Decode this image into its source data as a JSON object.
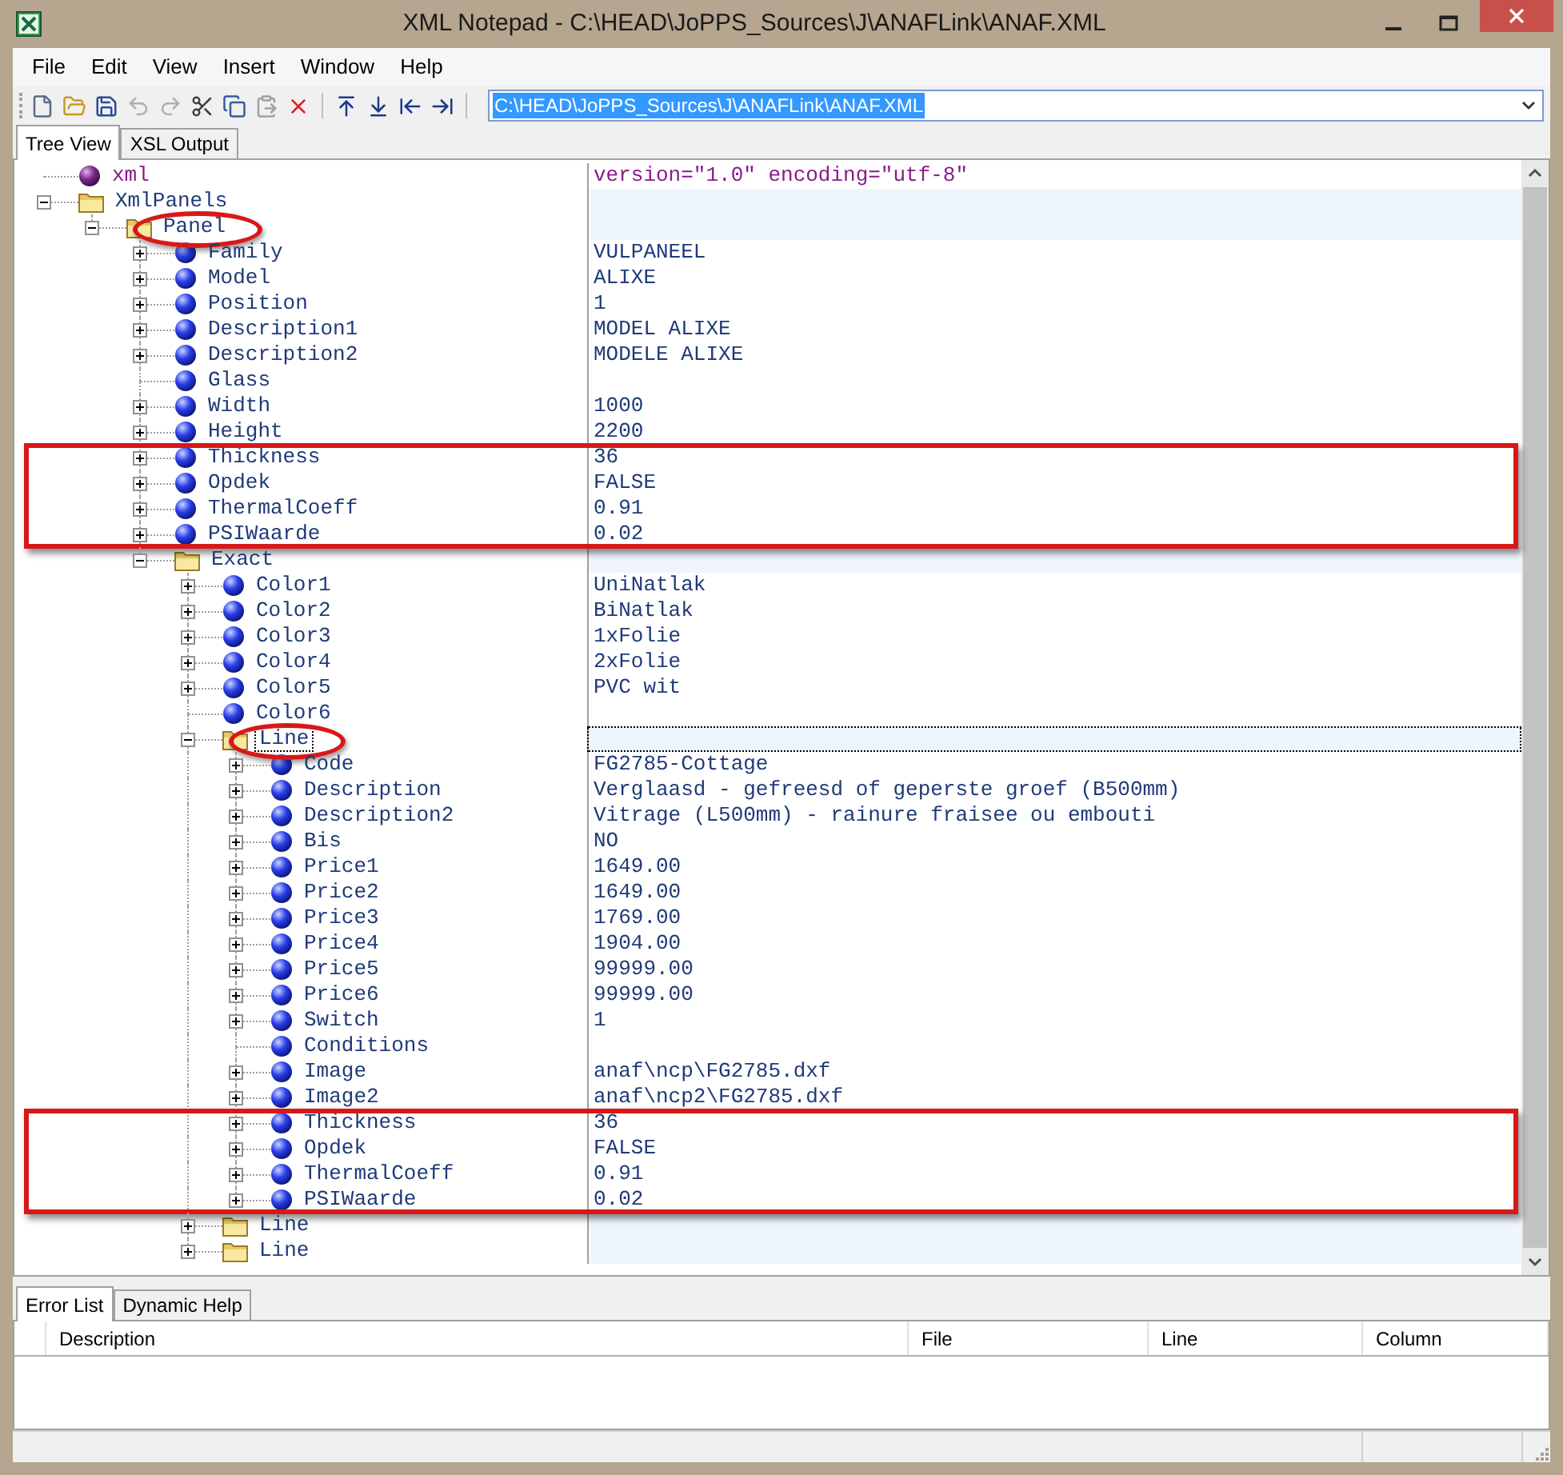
{
  "window": {
    "title": "XML Notepad - C:\\HEAD\\JoPPS_Sources\\J\\ANAFLink\\ANAF.XML"
  },
  "menu": [
    "File",
    "Edit",
    "View",
    "Insert",
    "Window",
    "Help"
  ],
  "toolbar": {
    "location": "C:\\HEAD\\JoPPS_Sources\\J\\ANAFLink\\ANAF.XML",
    "highlighted": true
  },
  "tabs": [
    {
      "label": "Tree View",
      "selected": true
    },
    {
      "label": "XSL Output",
      "selected": false
    }
  ],
  "tree": [
    {
      "name": "xml",
      "kind": "pi",
      "value": "version=\"1.0\" encoding=\"utf-8\"",
      "selected": false,
      "framed": false,
      "circled": false
    },
    {
      "name": "XmlPanels",
      "kind": "folder",
      "expanded": true,
      "selected": false,
      "framed": false,
      "circled": false,
      "children": [
        {
          "name": "Panel",
          "kind": "folder",
          "expanded": true,
          "selected": false,
          "framed": false,
          "circled": true,
          "children": [
            {
              "name": "Family",
              "kind": "element",
              "expanded": false,
              "value": "VULPANEEL",
              "selected": false,
              "framed": false,
              "circled": false
            },
            {
              "name": "Model",
              "kind": "element",
              "expanded": false,
              "value": "ALIXE",
              "selected": false,
              "framed": false,
              "circled": false
            },
            {
              "name": "Position",
              "kind": "element",
              "expanded": false,
              "value": "1",
              "selected": false,
              "framed": false,
              "circled": false
            },
            {
              "name": "Description1",
              "kind": "element",
              "expanded": false,
              "value": "MODEL ALIXE",
              "selected": false,
              "framed": false,
              "circled": false
            },
            {
              "name": "Description2",
              "kind": "element",
              "expanded": false,
              "value": "MODELE ALIXE",
              "selected": false,
              "framed": false,
              "circled": false
            },
            {
              "name": "Glass",
              "kind": "element",
              "selected": false,
              "framed": false,
              "circled": false
            },
            {
              "name": "Width",
              "kind": "element",
              "expanded": false,
              "value": "1000",
              "selected": false,
              "framed": false,
              "circled": false
            },
            {
              "name": "Height",
              "kind": "element",
              "expanded": false,
              "value": "2200",
              "selected": false,
              "framed": false,
              "circled": false
            },
            {
              "name": "Thickness",
              "kind": "element",
              "expanded": false,
              "value": "36",
              "selected": false,
              "framed": true,
              "circled": false
            },
            {
              "name": "Opdek",
              "kind": "element",
              "expanded": false,
              "value": "FALSE",
              "selected": false,
              "framed": true,
              "circled": false
            },
            {
              "name": "ThermalCoeff",
              "kind": "element",
              "expanded": false,
              "value": "0.91",
              "selected": false,
              "framed": true,
              "circled": false
            },
            {
              "name": "PSIWaarde",
              "kind": "element",
              "expanded": false,
              "value": "0.02",
              "selected": false,
              "framed": true,
              "circled": false
            },
            {
              "name": "Exact",
              "kind": "folder",
              "expanded": true,
              "selected": false,
              "framed": false,
              "circled": false,
              "children": [
                {
                  "name": "Color1",
                  "kind": "element",
                  "expanded": false,
                  "value": "UniNatlak",
                  "selected": false,
                  "framed": false,
                  "circled": false
                },
                {
                  "name": "Color2",
                  "kind": "element",
                  "expanded": false,
                  "value": "BiNatlak",
                  "selected": false,
                  "framed": false,
                  "circled": false
                },
                {
                  "name": "Color3",
                  "kind": "element",
                  "expanded": false,
                  "value": "1xFolie",
                  "selected": false,
                  "framed": false,
                  "circled": false
                },
                {
                  "name": "Color4",
                  "kind": "element",
                  "expanded": false,
                  "value": "2xFolie",
                  "selected": false,
                  "framed": false,
                  "circled": false
                },
                {
                  "name": "Color5",
                  "kind": "element",
                  "expanded": false,
                  "value": "PVC wit",
                  "selected": false,
                  "framed": false,
                  "circled": false
                },
                {
                  "name": "Color6",
                  "kind": "element",
                  "selected": false,
                  "framed": false,
                  "circled": false
                },
                {
                  "name": "Line",
                  "kind": "folder",
                  "expanded": true,
                  "selected": true,
                  "framed": false,
                  "circled": true,
                  "children": [
                    {
                      "name": "Code",
                      "kind": "element",
                      "expanded": false,
                      "value": "FG2785-Cottage",
                      "selected": false,
                      "framed": false,
                      "circled": false
                    },
                    {
                      "name": "Description",
                      "kind": "element",
                      "expanded": false,
                      "value": "Verglaasd - gefreesd of geperste groef (B500mm)",
                      "selected": false,
                      "framed": false,
                      "circled": false
                    },
                    {
                      "name": "Description2",
                      "kind": "element",
                      "expanded": false,
                      "value": "Vitrage (L500mm) - rainure fraisee ou embouti",
                      "selected": false,
                      "framed": false,
                      "circled": false
                    },
                    {
                      "name": "Bis",
                      "kind": "element",
                      "expanded": false,
                      "value": "NO",
                      "selected": false,
                      "framed": false,
                      "circled": false
                    },
                    {
                      "name": "Price1",
                      "kind": "element",
                      "expanded": false,
                      "value": "1649.00",
                      "selected": false,
                      "framed": false,
                      "circled": false
                    },
                    {
                      "name": "Price2",
                      "kind": "element",
                      "expanded": false,
                      "value": "1649.00",
                      "selected": false,
                      "framed": false,
                      "circled": false
                    },
                    {
                      "name": "Price3",
                      "kind": "element",
                      "expanded": false,
                      "value": "1769.00",
                      "selected": false,
                      "framed": false,
                      "circled": false
                    },
                    {
                      "name": "Price4",
                      "kind": "element",
                      "expanded": false,
                      "value": "1904.00",
                      "selected": false,
                      "framed": false,
                      "circled": false
                    },
                    {
                      "name": "Price5",
                      "kind": "element",
                      "expanded": false,
                      "value": "99999.00",
                      "selected": false,
                      "framed": false,
                      "circled": false
                    },
                    {
                      "name": "Price6",
                      "kind": "element",
                      "expanded": false,
                      "value": "99999.00",
                      "selected": false,
                      "framed": false,
                      "circled": false
                    },
                    {
                      "name": "Switch",
                      "kind": "element",
                      "expanded": false,
                      "value": "1",
                      "selected": false,
                      "framed": false,
                      "circled": false
                    },
                    {
                      "name": "Conditions",
                      "kind": "element",
                      "selected": false,
                      "framed": false,
                      "circled": false
                    },
                    {
                      "name": "Image",
                      "kind": "element",
                      "expanded": false,
                      "value": "anaf\\ncp\\FG2785.dxf",
                      "selected": false,
                      "framed": false,
                      "circled": false
                    },
                    {
                      "name": "Image2",
                      "kind": "element",
                      "expanded": false,
                      "value": "anaf\\ncp2\\FG2785.dxf",
                      "selected": false,
                      "framed": false,
                      "circled": false
                    },
                    {
                      "name": "Thickness",
                      "kind": "element",
                      "expanded": false,
                      "value": "36",
                      "selected": false,
                      "framed": true,
                      "circled": false
                    },
                    {
                      "name": "Opdek",
                      "kind": "element",
                      "expanded": false,
                      "value": "FALSE",
                      "selected": false,
                      "framed": true,
                      "circled": false
                    },
                    {
                      "name": "ThermalCoeff",
                      "kind": "element",
                      "expanded": false,
                      "value": "0.91",
                      "selected": false,
                      "framed": true,
                      "circled": false
                    },
                    {
                      "name": "PSIWaarde",
                      "kind": "element",
                      "expanded": false,
                      "value": "0.02",
                      "selected": false,
                      "framed": true,
                      "circled": false
                    }
                  ]
                },
                {
                  "name": "Line",
                  "kind": "folder",
                  "expanded": false,
                  "selected": false,
                  "framed": false,
                  "circled": false
                },
                {
                  "name": "Line",
                  "kind": "folder",
                  "expanded": false,
                  "selected": false,
                  "framed": false,
                  "circled": false
                }
              ]
            }
          ]
        }
      ]
    }
  ],
  "bottom_tabs": [
    {
      "label": "Error List",
      "selected": true
    },
    {
      "label": "Dynamic Help",
      "selected": false
    }
  ],
  "error_list": {
    "columns": [
      "Description",
      "File",
      "Line",
      "Column"
    ]
  }
}
